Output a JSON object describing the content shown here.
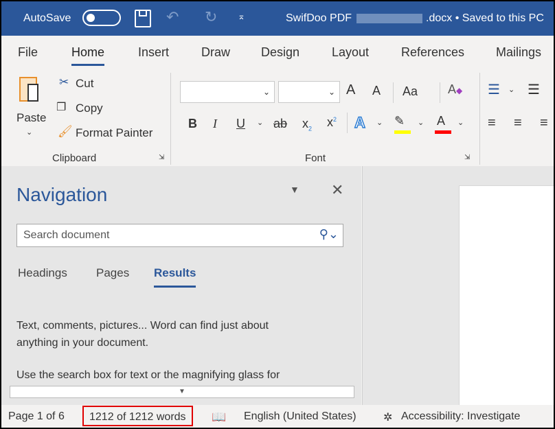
{
  "title_bar": {
    "autosave_label": "AutoSave",
    "autosave_on": false,
    "doc_title_prefix": "SwifDoo PDF",
    "doc_title_suffix": ".docx • Saved to this PC",
    "bg_color": "#2b579a"
  },
  "tabs": [
    {
      "label": "File"
    },
    {
      "label": "Home",
      "active": true
    },
    {
      "label": "Insert"
    },
    {
      "label": "Draw"
    },
    {
      "label": "Design"
    },
    {
      "label": "Layout"
    },
    {
      "label": "References"
    },
    {
      "label": "Mailings"
    }
  ],
  "ribbon": {
    "clipboard": {
      "paste": "Paste",
      "cut": "Cut",
      "copy": "Copy",
      "format_painter": "Format Painter",
      "group_label": "Clipboard"
    },
    "font": {
      "font_name": "",
      "font_size": "",
      "grow": "A",
      "shrink": "A",
      "change_case": "Aa",
      "bold": "B",
      "italic": "I",
      "underline": "U",
      "strike": "ab",
      "subscript": "x",
      "superscript": "x",
      "text_effects": "A",
      "font_color": "A",
      "group_label": "Font",
      "highlight_color": "#ffff00",
      "font_color_value": "#ff0000"
    }
  },
  "navigation": {
    "title": "Navigation",
    "search_placeholder": "Search document",
    "tabs": [
      {
        "label": "Headings"
      },
      {
        "label": "Pages"
      },
      {
        "label": "Results",
        "active": true
      }
    ],
    "help_text_1": "Text, comments, pictures... Word can find just about anything in your document.",
    "help_text_2": "Use the search box for text or the magnifying glass for"
  },
  "status_bar": {
    "page": "Page 1 of 6",
    "words": "1212 of 1212 words",
    "language": "English (United States)",
    "accessibility": "Accessibility: Investigate",
    "highlight_color": "#e00000"
  }
}
